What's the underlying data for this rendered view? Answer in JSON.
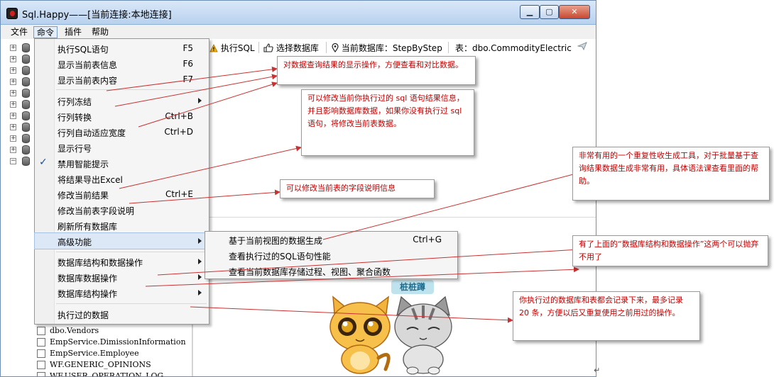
{
  "window": {
    "title": "Sql.Happy——[当前连接:本地连接]",
    "min_glyph": "▁",
    "max_glyph": "▢",
    "close_glyph": "✕"
  },
  "menubar": [
    "文件",
    "命令",
    "插件",
    "帮助"
  ],
  "toolbar": {
    "execute": "执行SQL",
    "select_db": "选择数据库",
    "current_db": "当前数据库：StepByStep",
    "table": "表：dbo.CommodityElectric"
  },
  "main_menu": [
    {
      "label": "执行SQL语句",
      "shortcut": "F5"
    },
    {
      "label": "显示当前表信息",
      "shortcut": "F6"
    },
    {
      "label": "显示当前表内容",
      "shortcut": "F7"
    },
    {
      "label": "行列冻结",
      "shortcut": "",
      "submenu": true
    },
    {
      "label": "行列转换",
      "shortcut": "Ctrl+B"
    },
    {
      "label": "行列自动适应宽度",
      "shortcut": "Ctrl+D"
    },
    {
      "label": "显示行号",
      "shortcut": ""
    },
    {
      "label": "禁用智能提示",
      "shortcut": "",
      "checked": true
    },
    {
      "label": "将结果导出Excel",
      "shortcut": ""
    },
    {
      "label": "修改当前结果",
      "shortcut": "Ctrl+E"
    },
    {
      "label": "修改当前表字段说明",
      "shortcut": ""
    },
    {
      "label": "刷新所有数据库",
      "shortcut": ""
    },
    {
      "label": "高级功能",
      "shortcut": "",
      "submenu": true,
      "highlighted": true
    },
    {
      "label": "数据库结构和数据操作",
      "shortcut": "",
      "submenu": true
    },
    {
      "label": "数据库数据操作",
      "shortcut": "",
      "submenu": true
    },
    {
      "label": "数据库结构操作",
      "shortcut": "",
      "submenu": true
    },
    {
      "label": "执行过的数据",
      "shortcut": ""
    }
  ],
  "check_glyph": "✓",
  "sub_menu": [
    {
      "label": "基于当前视图的数据生成",
      "shortcut": "Ctrl+G"
    },
    {
      "label": "查看执行过的SQL语句性能",
      "shortcut": ""
    },
    {
      "label": "查看当前数据库存储过程、视图、聚合函数",
      "shortcut": ""
    }
  ],
  "tables": [
    "dbo.Vendors",
    "EmpService.DimissionInformation",
    "EmpService.Employee",
    "WF.GENERIC_OPINIONS",
    "WF.USER_OPERATION_LOG"
  ],
  "callouts": {
    "c1": "对数据查询结果的显示操作，方便查看和对比数据。",
    "c2": "可以修改当前你执行过的 sql 语句结果信息，并且影响数据库数据，如果你没有执行过 sql 语句，将修改当前表数据。",
    "c3": "可以修改当前表的字段说明信息",
    "c4": "非常有用的一个重复性收生成工具，对于批量基于查询结果数据生成非常有用，具体语法课查看里面的帮助。",
    "c5": "有了上面的“数据库结构和数据操作”这两个可以抛弃不用了",
    "c6": "你执行过的数据库和表都会记录下来，最多记录 20 条，方便以后又重复使用之前用过的操作。"
  },
  "mascot_sign": "桩桩蹲",
  "cursor_glyph": "↵",
  "colors": {
    "callout_text": "#c00000",
    "arrow": "#c83232",
    "menu_highlight": "#dce8f6"
  }
}
